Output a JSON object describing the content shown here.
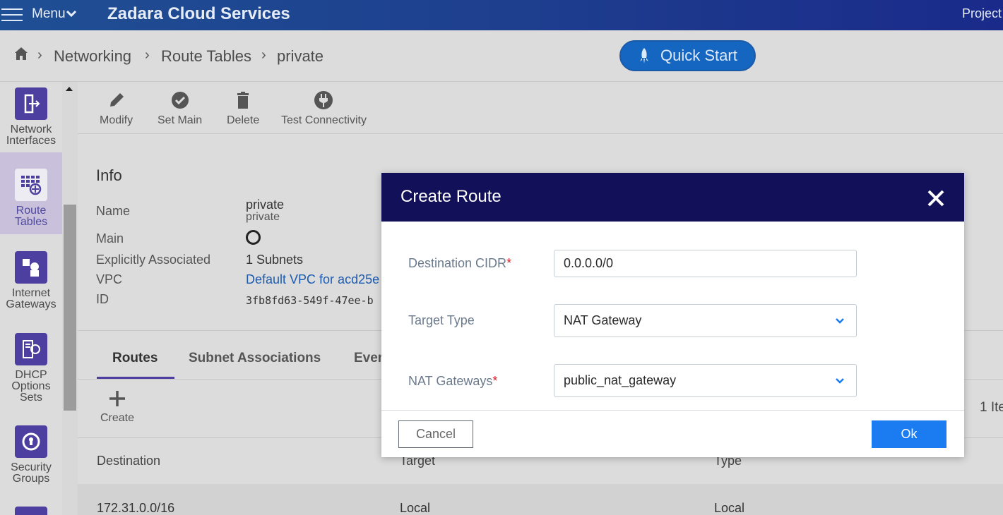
{
  "topbar": {
    "menu_label": "Menu",
    "app_title": "Zadara Cloud Services",
    "project_label": "Project"
  },
  "breadcrumb": {
    "items": [
      "Networking",
      "Route Tables",
      "private"
    ],
    "quick_start": "Quick Start"
  },
  "sidebar": {
    "items": [
      {
        "label_line1": "Network",
        "label_line2": "Interfaces",
        "line3": "",
        "icon": "network-interfaces-icon"
      },
      {
        "label_line1": "Route",
        "label_line2": "Tables",
        "line3": "",
        "icon": "route-tables-icon",
        "active": true
      },
      {
        "label_line1": "Internet",
        "label_line2": "Gateways",
        "line3": "",
        "icon": "internet-gateways-icon"
      },
      {
        "label_line1": "DHCP",
        "label_line2": "Options",
        "line3": "Sets",
        "icon": "dhcp-options-icon"
      },
      {
        "label_line1": "Security",
        "label_line2": "Groups",
        "line3": "",
        "icon": "security-groups-icon"
      }
    ]
  },
  "toolbar": {
    "modify": "Modify",
    "set_main": "Set Main",
    "delete": "Delete",
    "test_connectivity": "Test Connectivity"
  },
  "info": {
    "title": "Info",
    "name_label": "Name",
    "name_value": "private",
    "name_sub": "private",
    "main_label": "Main",
    "assoc_label": "Explicitly Associated",
    "assoc_value": "1 Subnets",
    "vpc_label": "VPC",
    "vpc_value": "Default VPC for acd25e",
    "id_label": "ID",
    "id_value": "3fb8fd63-549f-47ee-b"
  },
  "tabs": {
    "routes": "Routes",
    "subnet_associations": "Subnet Associations",
    "events": "Even"
  },
  "routes": {
    "create": "Create",
    "item_count": "1 Ite",
    "columns": [
      "Destination",
      "Target",
      "Type"
    ],
    "rows": [
      {
        "destination": "172.31.0.0/16",
        "target": "Local",
        "type": "Local"
      }
    ]
  },
  "modal": {
    "title": "Create Route",
    "destination_label": "Destination CIDR",
    "destination_value": "0.0.0.0/0",
    "target_type_label": "Target Type",
    "target_type_value": "NAT Gateway",
    "nat_label": "NAT Gateways",
    "nat_value": "public_nat_gateway",
    "required_mark": "*",
    "cancel": "Cancel",
    "ok": "Ok"
  }
}
